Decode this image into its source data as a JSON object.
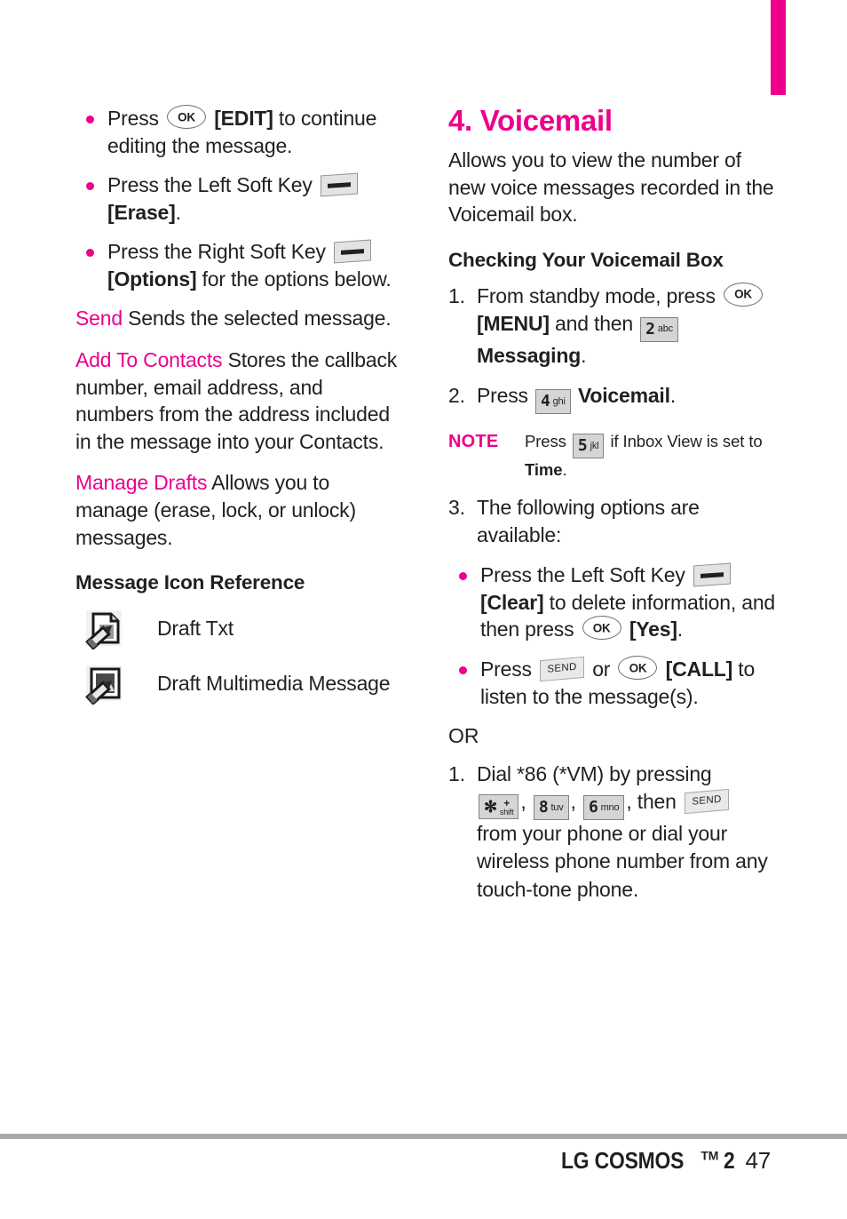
{
  "page": {
    "tab_marker_color": "#ec008c",
    "accent_color": "#ec008c",
    "text_color": "#231f20"
  },
  "footer": {
    "brand": "LG COSMOS",
    "tm": "TM",
    "model": "2",
    "page_number": "47"
  },
  "left_column": {
    "bullets": [
      {
        "pre": "Press",
        "key": "ok-key",
        "mid_bold": "[EDIT]",
        "post": " to continue editing the message."
      },
      {
        "pre": "Press the Left Soft Key",
        "key": "soft-key",
        "mid_bold": "[Erase]",
        "post": "."
      },
      {
        "pre": "Press the Right Soft Key",
        "key": "soft-key",
        "mid_bold": "[Options]",
        "post": " for the options below."
      }
    ],
    "definitions": [
      {
        "term": "Send",
        "description": "Sends the selected message."
      },
      {
        "term": "Add To Contacts",
        "description": "Stores the callback number, email address, and numbers from the address included in the message into your Contacts."
      },
      {
        "term": "Manage Drafts",
        "description": "Allows you to manage (erase, lock, or unlock) messages."
      }
    ],
    "icon_reference": {
      "heading": "Message Icon Reference",
      "rows": [
        {
          "icon": "draft-txt-icon",
          "label": "Draft Txt"
        },
        {
          "icon": "draft-multimedia-message-icon",
          "label": "Draft Multimedia Message"
        }
      ]
    }
  },
  "right_column": {
    "section_title": "4. Voicemail",
    "intro": "Allows you to view the number of new voice messages recorded in the Voicemail box.",
    "subheading": "Checking Your Voicemail Box",
    "steps": [
      {
        "num": "1.",
        "part1": "From standby mode, press",
        "key1": "ok-key",
        "bold1": "[MENU]",
        "part2": " and then",
        "key2": "2-abc-key",
        "bold2": "Messaging",
        "part3": "."
      },
      {
        "num": "2.",
        "part1": "Press",
        "key1": "4-ghi-key",
        "bold1": "Voicemail",
        "part2": "."
      }
    ],
    "note": {
      "label": "NOTE",
      "part1": "Press",
      "key": "5-jkl-key",
      "part2": " if Inbox View is set to ",
      "bold": "Time",
      "part3": "."
    },
    "step3": {
      "num": "3.",
      "text": "The following options are available:"
    },
    "option_bullets": [
      {
        "pre": "Press the Left Soft Key",
        "key1": "soft-key",
        "bold1": "[Clear]",
        "mid": " to delete information, and then press",
        "key2": "ok-key",
        "bold2": "[Yes]",
        "post": "."
      },
      {
        "pre": "Press",
        "key1": "send-key",
        "mid1": " or",
        "key2": "ok-key",
        "bold1": "[CALL]",
        "post": " to listen to the message(s)."
      }
    ],
    "or_text": "OR",
    "dial_step": {
      "num": "1.",
      "part1": "Dial *86 (*VM) by pressing",
      "key1": "star-shift-key",
      "sep1": ",",
      "key2": "8-tuv-key",
      "sep2": ",",
      "key3": "6-mno-key",
      "sep3": ", then",
      "key4": "send-key",
      "part2": " from your phone or dial your wireless phone number from any touch-tone phone."
    }
  },
  "keys": {
    "ok": "OK",
    "send": "SEND",
    "two": {
      "digit": "2",
      "letters": "abc"
    },
    "four": {
      "digit": "4",
      "letters": "ghi"
    },
    "five": {
      "digit": "5",
      "letters": "jkl"
    },
    "six": {
      "digit": "6",
      "letters": "mno"
    },
    "eight": {
      "digit": "8",
      "letters": "tuv"
    },
    "star": {
      "glyph": "✻",
      "plus": "+",
      "shift": "shift"
    }
  }
}
